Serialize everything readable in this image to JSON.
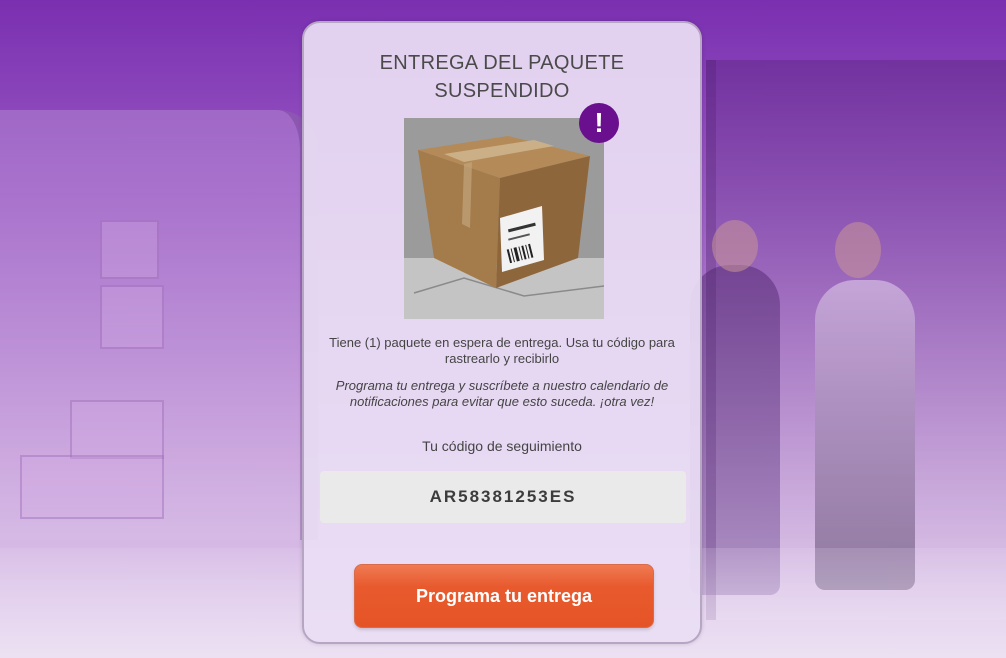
{
  "card": {
    "title_line1": "ENTREGA DEL PAQUETE",
    "title_line2": "SUSPENDIDO",
    "alert_icon": "exclamation-icon",
    "alert_symbol": "!",
    "package_image": "cardboard-package-photo",
    "message": "Tiene (1) paquete en espera de entrega. Usa tu código para rastrearlo y recibirlo",
    "note": "Programa tu entrega y suscríbete a nuestro calendario de notificaciones para evitar que esto suceda. ¡otra vez!",
    "tracking_label": "Tu código de seguimiento",
    "tracking_code": "AR58381253ES",
    "cta_label": "Programa tu entrega"
  },
  "colors": {
    "accent_purple": "#6a0f8e",
    "button_orange": "#e85a2e",
    "background_purple": "#7a2fb0"
  }
}
